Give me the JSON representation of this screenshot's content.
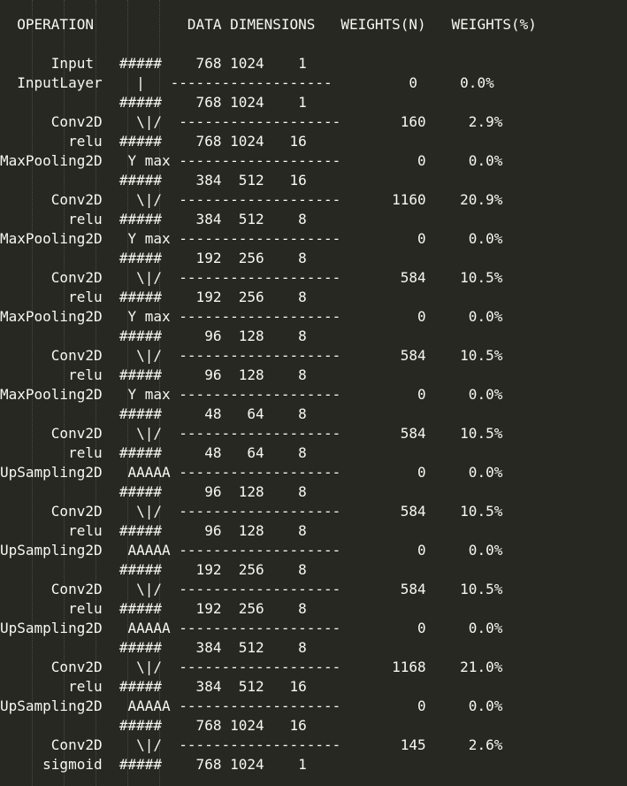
{
  "lines": [
    "  OPERATION           DATA DIMENSIONS   WEIGHTS(N)   WEIGHTS(%)",
    "",
    "      Input   #####    768 1024    1",
    "  InputLayer    |   -------------------         0     0.0%",
    "              #####    768 1024    1",
    "      Conv2D    \\|/  -------------------       160     2.9%",
    "        relu  #####    768 1024   16",
    "MaxPooling2D   Y max -------------------         0     0.0%",
    "              #####    384  512   16",
    "      Conv2D    \\|/  -------------------      1160    20.9%",
    "        relu  #####    384  512    8",
    "MaxPooling2D   Y max -------------------         0     0.0%",
    "              #####    192  256    8",
    "      Conv2D    \\|/  -------------------       584    10.5%",
    "        relu  #####    192  256    8",
    "MaxPooling2D   Y max -------------------         0     0.0%",
    "              #####     96  128    8",
    "      Conv2D    \\|/  -------------------       584    10.5%",
    "        relu  #####     96  128    8",
    "MaxPooling2D   Y max -------------------         0     0.0%",
    "              #####     48   64    8",
    "      Conv2D    \\|/  -------------------       584    10.5%",
    "        relu  #####     48   64    8",
    "UpSampling2D   AAAAA -------------------         0     0.0%",
    "              #####     96  128    8",
    "      Conv2D    \\|/  -------------------       584    10.5%",
    "        relu  #####     96  128    8",
    "UpSampling2D   AAAAA -------------------         0     0.0%",
    "              #####    192  256    8",
    "      Conv2D    \\|/  -------------------       584    10.5%",
    "        relu  #####    192  256    8",
    "UpSampling2D   AAAAA -------------------         0     0.0%",
    "              #####    384  512    8",
    "      Conv2D    \\|/  -------------------      1168    21.0%",
    "        relu  #####    384  512   16",
    "UpSampling2D   AAAAA -------------------         0     0.0%",
    "              #####    768 1024   16",
    "      Conv2D    \\|/  -------------------       145     2.6%",
    "     sigmoid  #####    768 1024    1"
  ]
}
